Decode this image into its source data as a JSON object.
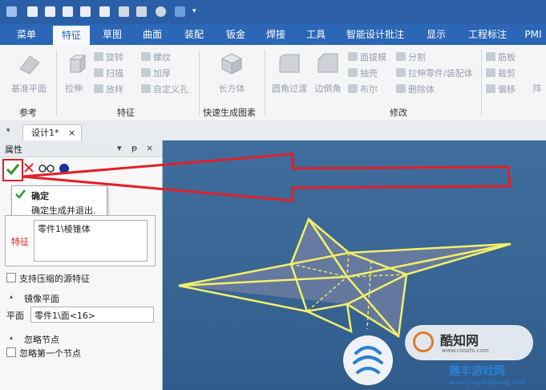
{
  "tabs": [
    "菜单",
    "特征",
    "草图",
    "曲面",
    "装配",
    "钣金",
    "焊接",
    "工具",
    "智能设计批注",
    "显示",
    "工程标注",
    "PMI"
  ],
  "active_tab_index": 1,
  "ribbon": {
    "group1": {
      "big": "基准平面",
      "label": "参考"
    },
    "group2": {
      "big": "拉伸",
      "small_col1": [
        "旋转",
        "扫描",
        "放样"
      ],
      "small_col2": [
        "螺纹",
        "加厚",
        "自定义孔"
      ],
      "label": "特征"
    },
    "group3": {
      "big": "长方体",
      "label": "快速生成图素"
    },
    "group4": {
      "big1": "圆角过渡",
      "big2": "边倒角",
      "small_col1": [
        "面拔模",
        "抽壳",
        "布尔"
      ],
      "small_col2": [
        "分割",
        "拉伸零件/装配体",
        "删除体"
      ],
      "label": "修改"
    },
    "group5": {
      "small": [
        "筋板",
        "裁剪",
        "偏移"
      ],
      "partial": "阵"
    }
  },
  "document_tab": "设计1*",
  "document_tab_close": "×",
  "panel": {
    "title": "属性",
    "header_controls": [
      "▾",
      "ᵽ",
      "×"
    ],
    "confirm_tooltip_title": "确定",
    "confirm_tooltip_desc": "确定生成并退出.",
    "feature_label": "特征",
    "feature_value": "零件1\\棱锥体",
    "checkbox_source": "支持压缩的源特征",
    "mirror_section": "镜像平面",
    "plane_label": "平面",
    "plane_value": "零件1\\面<16>",
    "ignore_section": "忽略节点",
    "checkbox_ignore": "忽略第一个节点"
  },
  "watermark": {
    "text": "酷知网",
    "sub": "www.coozhi.com",
    "site": "趣丰游戏网",
    "site_url": "www.yueyangbang.com"
  },
  "colors": {
    "accent": "#2b67b6",
    "confirm_green": "#2a9b2a",
    "cancel_red": "#e03030",
    "arrow_red": "#e0202a",
    "star_outline": "#f2ef6a"
  }
}
